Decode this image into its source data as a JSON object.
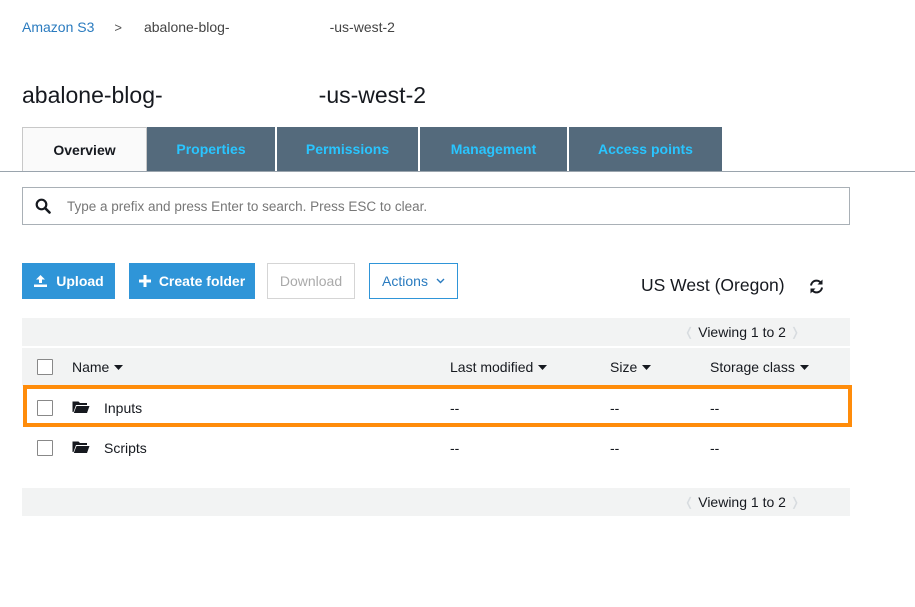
{
  "breadcrumb": {
    "root": "Amazon S3",
    "separator": ">",
    "current_prefix": "abalone-blog-",
    "current_suffix": "-us-west-2"
  },
  "page_title": {
    "prefix": "abalone-blog-",
    "suffix": "-us-west-2"
  },
  "tabs": [
    {
      "label": "Overview",
      "active": true
    },
    {
      "label": "Properties",
      "active": false
    },
    {
      "label": "Permissions",
      "active": false
    },
    {
      "label": "Management",
      "active": false
    },
    {
      "label": "Access points",
      "active": false
    }
  ],
  "search": {
    "placeholder": "Type a prefix and press Enter to search. Press ESC to clear.",
    "value": ""
  },
  "toolbar": {
    "upload_label": "Upload",
    "create_folder_label": "Create folder",
    "download_label": "Download",
    "actions_label": "Actions"
  },
  "region": "US West (Oregon)",
  "paging": {
    "top": "Viewing 1 to 2",
    "bottom": "Viewing 1 to 2"
  },
  "table": {
    "columns": [
      "Name",
      "Last modified",
      "Size",
      "Storage class"
    ],
    "rows": [
      {
        "name": "Inputs",
        "last_modified": "--",
        "size": "--",
        "storage_class": "--",
        "type": "folder",
        "highlighted": true
      },
      {
        "name": "Scripts",
        "last_modified": "--",
        "size": "--",
        "storage_class": "--",
        "type": "folder",
        "highlighted": false
      }
    ]
  },
  "colors": {
    "link": "#2a7bbf",
    "tab_background": "#546a7c",
    "tab_text": "#29c5ff",
    "primary_button": "#2f95d8",
    "highlight_border": "#ff8c0a"
  },
  "icons": [
    "search-icon",
    "upload-icon",
    "plus-icon",
    "chevron-down-icon",
    "refresh-icon",
    "folder-icon",
    "caret-down-icon"
  ]
}
